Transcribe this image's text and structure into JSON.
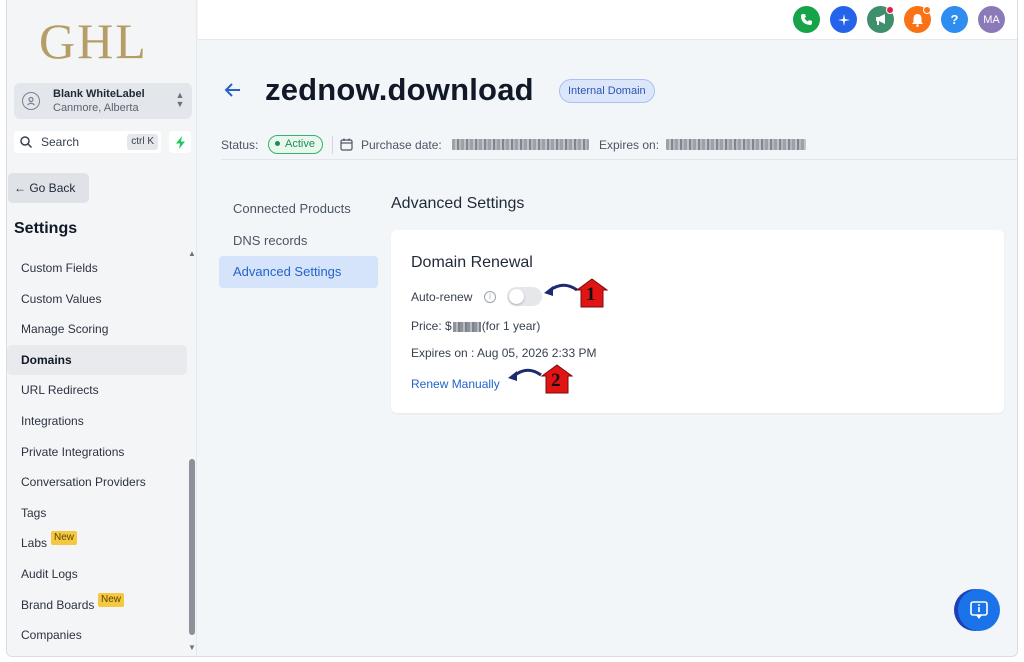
{
  "brand": {
    "logo_text": "GHL"
  },
  "account": {
    "name": "Blank WhiteLabel",
    "location": "Canmore, Alberta"
  },
  "search": {
    "label": "Search",
    "shortcut": "ctrl K"
  },
  "sidebar": {
    "go_back": "Go Back",
    "title": "Settings",
    "items": [
      {
        "label": "Custom Fields"
      },
      {
        "label": "Custom Values"
      },
      {
        "label": "Manage Scoring"
      },
      {
        "label": "Domains"
      },
      {
        "label": "URL Redirects"
      },
      {
        "label": "Integrations"
      },
      {
        "label": "Private Integrations"
      },
      {
        "label": "Conversation Providers"
      },
      {
        "label": "Tags"
      },
      {
        "label": "Labs",
        "badge": "New"
      },
      {
        "label": "Audit Logs"
      },
      {
        "label": "Brand Boards",
        "badge": "New"
      },
      {
        "label": "Companies"
      }
    ],
    "active_item": "Domains"
  },
  "topbar": {
    "icons": [
      {
        "name": "phone-icon",
        "color": "#16a34a"
      },
      {
        "name": "sparkle-icon",
        "color": "#2563eb"
      },
      {
        "name": "megaphone-icon",
        "color": "#3f8f6c",
        "dot": "#e11d48"
      },
      {
        "name": "bell-icon",
        "color": "#f97316",
        "dot": "#f97316"
      },
      {
        "name": "help-icon",
        "color": "#2f8cf0",
        "text": "?"
      }
    ],
    "avatar_initials": "MA",
    "avatar_color": "#8b7ab8"
  },
  "domain": {
    "name": "zednow.download",
    "badge": "Internal Domain",
    "status_label": "Status:",
    "status_value": "Active",
    "purchase_label": "Purchase date:",
    "expires_label": "Expires on:"
  },
  "subnav": {
    "items": [
      {
        "label": "Connected Products"
      },
      {
        "label": "DNS records"
      },
      {
        "label": "Advanced Settings"
      }
    ],
    "active_item": "Advanced Settings"
  },
  "advanced": {
    "section_title": "Advanced Settings",
    "card_title": "Domain Renewal",
    "auto_renew_label": "Auto-renew",
    "auto_renew_enabled": false,
    "price_prefix": "Price: $",
    "price_suffix": "(for 1 year)",
    "expires_text": "Expires on : Aug 05, 2026 2:33 PM",
    "renew_link": "Renew Manually"
  },
  "callouts": [
    {
      "number": "1"
    },
    {
      "number": "2"
    }
  ],
  "colors": {
    "accent": "#2563c9",
    "callout_red": "#e11414",
    "callout_arrow": "#1e2a6e",
    "logo_gold": "#b59d66"
  }
}
